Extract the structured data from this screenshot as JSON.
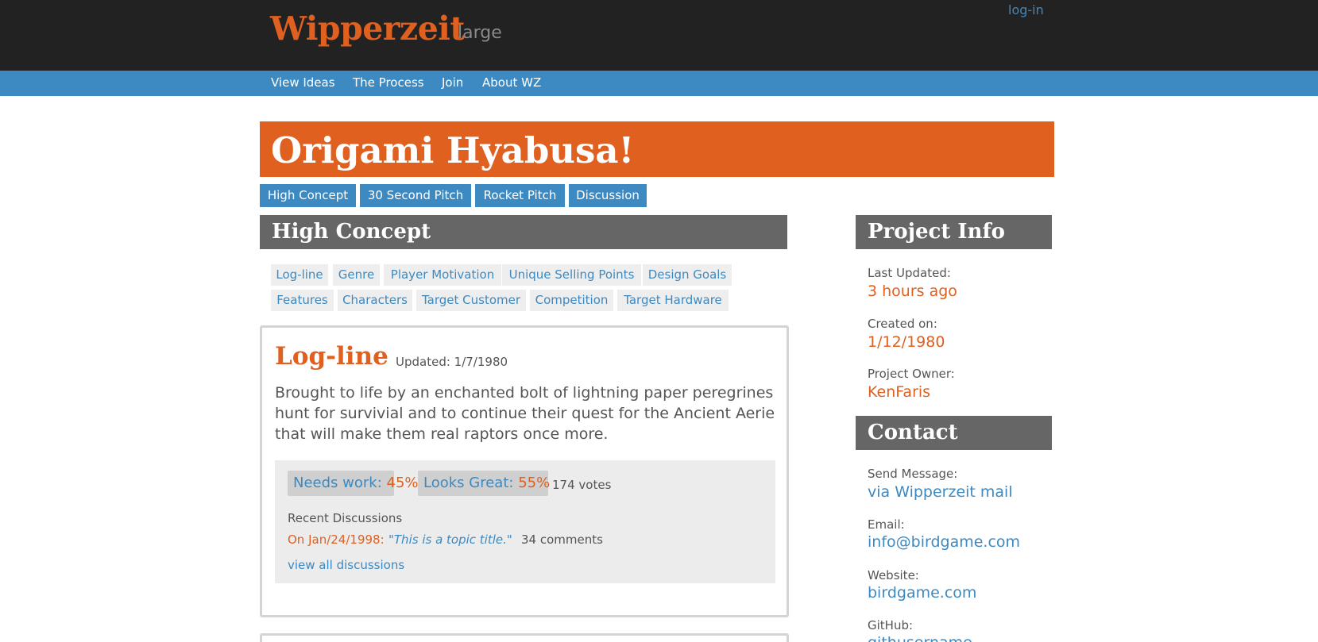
{
  "header": {
    "logo": "Wipperzeit",
    "logo_sub": "large",
    "login": "log-in"
  },
  "nav": {
    "items": [
      "View Ideas",
      "The Process",
      "Join",
      "About WZ"
    ]
  },
  "project": {
    "title": "Origami Hyabusa!",
    "tabs": [
      "High Concept",
      "30 Second Pitch",
      "Rocket Pitch",
      "Discussion"
    ]
  },
  "high_concept": {
    "heading": "High Concept",
    "subtags_row1": [
      "Log-line",
      "Genre",
      "Player Motivation",
      "Unique Selling Points",
      "Design Goals"
    ],
    "subtags_row2": [
      "Features",
      "Characters",
      "Target Customer",
      "Competition",
      "Target Hardware"
    ]
  },
  "logline_card": {
    "title": "Log-line",
    "updated": "Updated: 1/7/1980",
    "body": "Brought to life by an enchanted bolt of lightning paper peregrines hunt for survivial and to continue their quest for the Ancient Aerie that will make them real raptors once more.",
    "needs_work_label": "Needs work:",
    "needs_work_pct": "45%",
    "looks_great_label": "Looks Great:",
    "looks_great_pct": "55%",
    "votes": "174 votes",
    "recent_label": "Recent Discussions",
    "discussion_date": "On Jan/24/1998:",
    "discussion_title": "\"This is a topic title.\"",
    "discussion_comments": "34 comments",
    "view_all": "view all discussions"
  },
  "project_info": {
    "heading": "Project Info",
    "last_updated_label": "Last Updated:",
    "last_updated": "3 hours ago",
    "created_label": "Created on:",
    "created": "1/12/1980",
    "owner_label": "Project Owner:",
    "owner": "KenFaris"
  },
  "contact": {
    "heading": "Contact",
    "message_label": "Send Message:",
    "message": "via Wipperzeit mail",
    "email_label": "Email:",
    "email": "info@birdgame.com",
    "website_label": "Website:",
    "website": "birdgame.com",
    "github_label": "GitHub:",
    "github": "githusername"
  },
  "colors": {
    "accent_orange": "#e0601f",
    "accent_blue": "#3d89c1",
    "header_dark": "#222222",
    "section_gray": "#666666"
  }
}
